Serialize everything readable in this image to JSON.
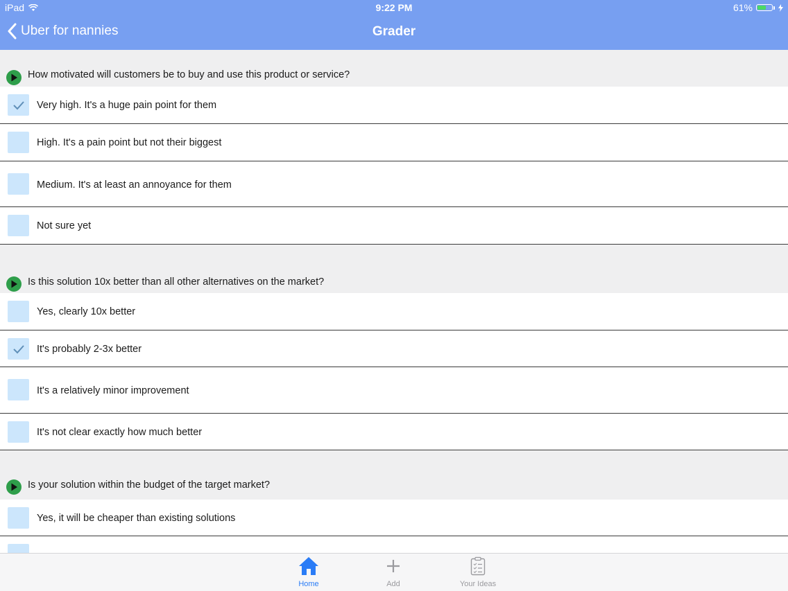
{
  "status_bar": {
    "device": "iPad",
    "time": "9:22 PM",
    "battery": "61%",
    "battery_level": 0.61
  },
  "nav": {
    "back_label": "Uber for nannies",
    "title": "Grader"
  },
  "questions": [
    {
      "text": "How motivated will customers be to buy and use this product or service?",
      "options": [
        {
          "label": "Very high. It's a huge pain point for them",
          "checked": true
        },
        {
          "label": "High. It's a pain point but not their biggest",
          "checked": false
        },
        {
          "label": "Medium. It's at least an annoyance for them",
          "checked": false
        },
        {
          "label": "Not sure yet",
          "checked": false
        }
      ]
    },
    {
      "text": "Is this solution 10x better than all other alternatives on the market?",
      "options": [
        {
          "label": "Yes, clearly 10x better",
          "checked": false
        },
        {
          "label": "It's probably 2-3x better",
          "checked": true
        },
        {
          "label": "It's a relatively minor improvement",
          "checked": false
        },
        {
          "label": "It's not clear exactly how much better",
          "checked": false
        }
      ]
    },
    {
      "text": "Is your solution within the budget of the target market?",
      "options": [
        {
          "label": "Yes, it will be cheaper than existing solutions",
          "checked": false
        },
        {
          "label": "",
          "checked": false
        }
      ]
    }
  ],
  "tab_bar": {
    "home": "Home",
    "add": "Add",
    "ideas": "Your Ideas"
  },
  "colors": {
    "header": "#779ff1",
    "checkbox": "#cce6fc",
    "check_mark": "#5f8fb8",
    "arrow_icon": "#2e9e4a",
    "tab_active": "#2a7cf6"
  }
}
